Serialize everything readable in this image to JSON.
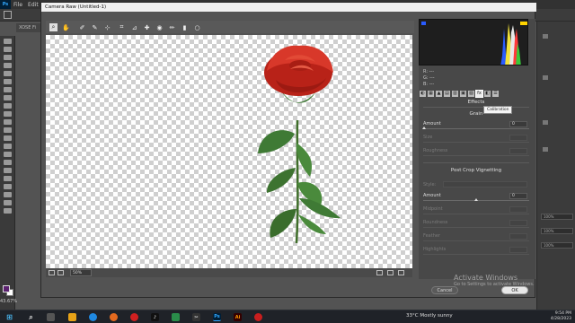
{
  "ps": {
    "menu": [
      "File",
      "Edit"
    ],
    "doc_tab": "XOSE Fi",
    "zoom": "43.67%",
    "right_rows": [
      "100%",
      "100%",
      "100%"
    ]
  },
  "dialog": {
    "title": "Camera Raw (Untitled-1)",
    "zoom_level": "50%",
    "histogram": {
      "r": "R:  ---",
      "g": "G:  ---",
      "b": "B:  ---"
    },
    "panel_title": "Effects",
    "tooltip": "Calibration",
    "grain": {
      "heading": "Grain",
      "amount_label": "Amount",
      "amount_value": "0",
      "size_label": "Size",
      "roughness_label": "Roughness"
    },
    "vignette": {
      "heading": "Post Crop Vignetting",
      "style_label": "Style:",
      "amount_label": "Amount",
      "amount_value": "0",
      "midpoint_label": "Midpoint",
      "roundness_label": "Roundness",
      "feather_label": "Feather",
      "highlights_label": "Highlights"
    },
    "cancel_label": "Cancel",
    "ok_label": "OK"
  },
  "watermark": {
    "line1": "Activate Windows",
    "line2": "Go to Settings to activate Windows."
  },
  "taskbar": {
    "weather": "33°C  Mostly sunny",
    "time": "9:54 PM",
    "date": "4/28/2023",
    "ps_icon": "Ps",
    "ai_icon": "Ai"
  },
  "colors": {
    "accent": "#31a8ff",
    "rose_red": "#c8281c",
    "leaf_green": "#3f7a35"
  }
}
